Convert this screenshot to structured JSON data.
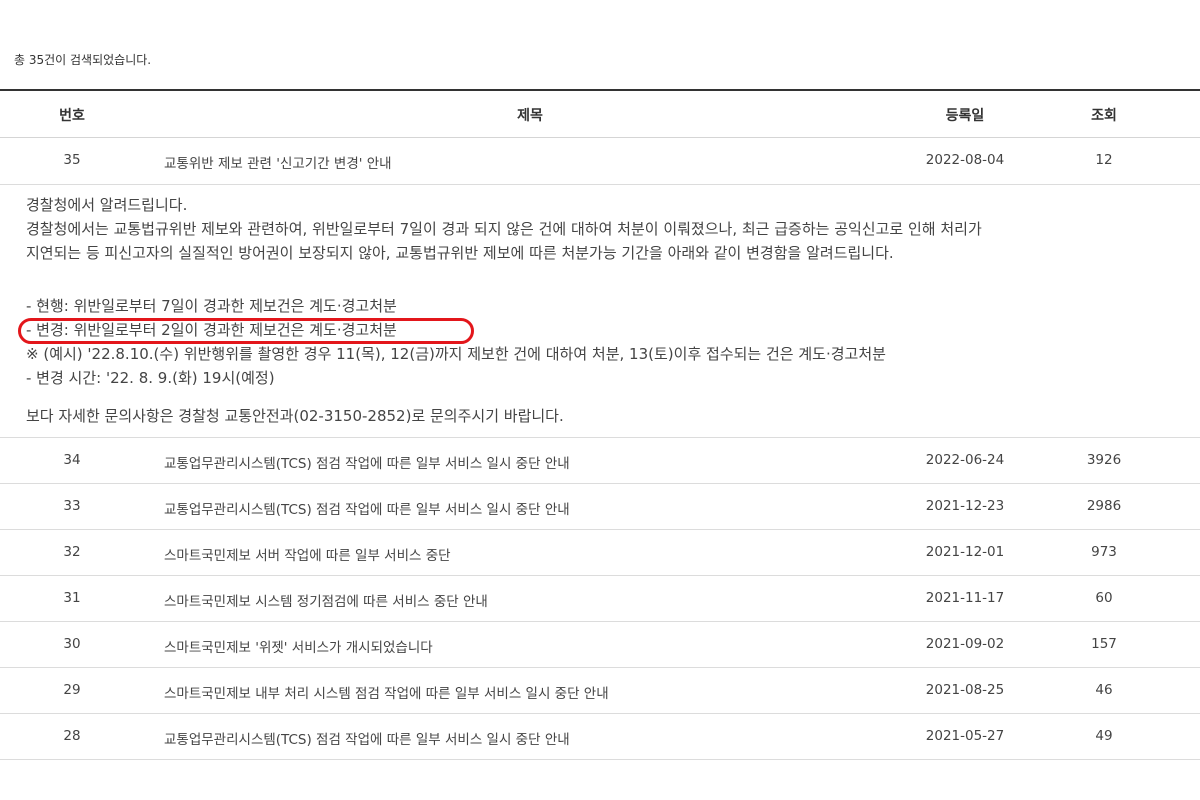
{
  "summary": "총 35건이 검색되었습니다.",
  "columns": {
    "num": "번호",
    "title": "제목",
    "date": "등록일",
    "views": "조회"
  },
  "opened": {
    "num": "35",
    "title": "교통위반 제보 관련 '신고기간 변경' 안내",
    "date": "2022-08-04",
    "views": "12",
    "lines": [
      "경찰청에서 알려드립니다.",
      "경찰청에서는 교통법규위반 제보와 관련하여, 위반일로부터 7일이 경과 되지 않은 건에 대하여 처분이 이뤄졌으나, 최근 급증하는 공익신고로 인해 처리가",
      "지연되는 등 피신고자의 실질적인 방어권이 보장되지 않아, 교통법규위반 제보에 따른 처분가능 기간을 아래와 같이 변경함을 알려드립니다.",
      "- 현행: 위반일로부터 7일이 경과한 제보건은 계도·경고처분",
      "- 변경: 위반일로부터 2일이 경과한 제보건은 계도·경고처분",
      "※ (예시) '22.8.10.(수) 위반행위를 촬영한 경우 11(목), 12(금)까지 제보한 건에 대하여 처분, 13(토)이후 접수되는 건은 계도·경고처분",
      "- 변경 시간: '22. 8. 9.(화) 19시(예정)",
      "보다 자세한 문의사항은 경찰청 교통안전과(02-3150-2852)로 문의주시기 바랍니다."
    ]
  },
  "rows": [
    {
      "num": "34",
      "title": "교통업무관리시스템(TCS) 점검 작업에 따른 일부 서비스 일시 중단 안내",
      "date": "2022-06-24",
      "views": "3926"
    },
    {
      "num": "33",
      "title": "교통업무관리시스템(TCS) 점검 작업에 따른 일부 서비스 일시 중단 안내",
      "date": "2021-12-23",
      "views": "2986"
    },
    {
      "num": "32",
      "title": "스마트국민제보 서버 작업에 따른 일부 서비스 중단",
      "date": "2021-12-01",
      "views": "973"
    },
    {
      "num": "31",
      "title": "스마트국민제보 시스템 정기점검에 따른 서비스 중단 안내",
      "date": "2021-11-17",
      "views": "60"
    },
    {
      "num": "30",
      "title": "스마트국민제보 '위젯' 서비스가 개시되었습니다",
      "date": "2021-09-02",
      "views": "157"
    },
    {
      "num": "29",
      "title": "스마트국민제보 내부 처리 시스템 점검 작업에 따른 일부 서비스 일시 중단 안내",
      "date": "2021-08-25",
      "views": "46"
    },
    {
      "num": "28",
      "title": "교통업무관리시스템(TCS) 점검 작업에 따른 일부 서비스 일시 중단 안내",
      "date": "2021-05-27",
      "views": "49"
    }
  ],
  "colors": {
    "highlight": "#e3161b",
    "header_border": "#333333",
    "row_border": "#dcdcdc"
  }
}
